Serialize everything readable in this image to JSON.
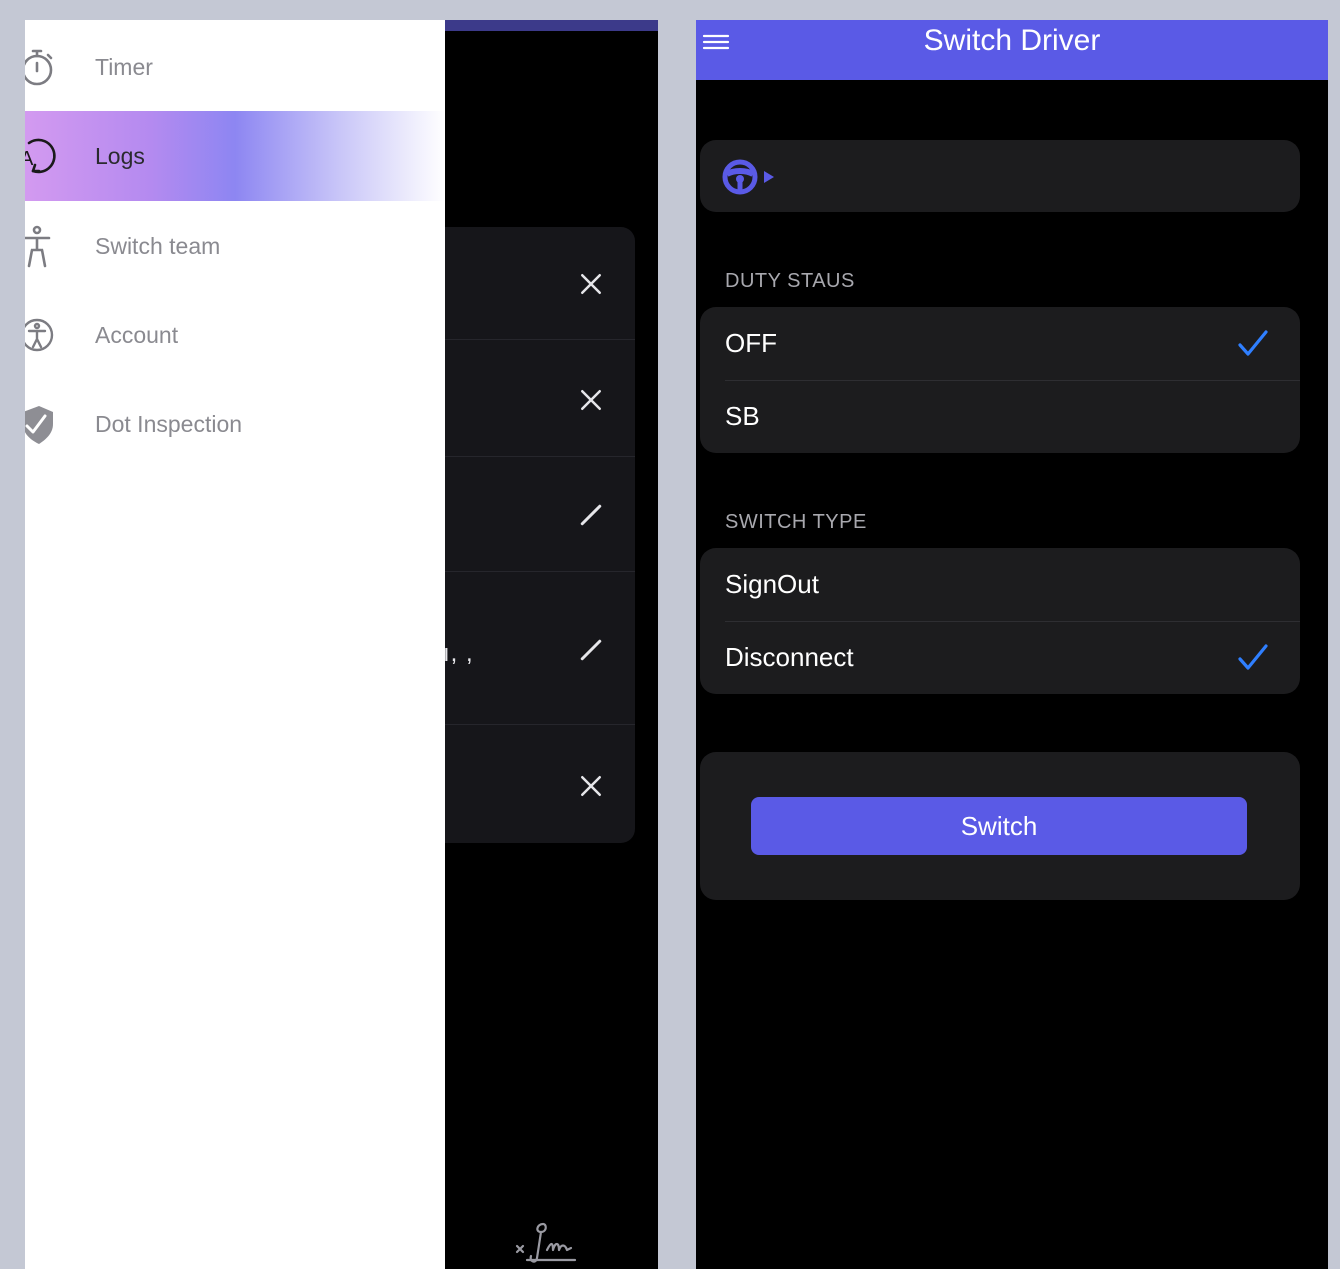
{
  "drawer": {
    "items": [
      {
        "label": "Timer",
        "icon": "timer-icon",
        "active": false
      },
      {
        "label": "Logs",
        "icon": "logs-icon",
        "active": true
      },
      {
        "label": "Switch team",
        "icon": "switch-team-icon",
        "active": false
      },
      {
        "label": "Account",
        "icon": "account-icon",
        "active": false
      },
      {
        "label": "Dot Inspection",
        "icon": "shield-check-icon",
        "active": false
      }
    ]
  },
  "behind": {
    "partial_text": "ı, ,",
    "actions": [
      "close-icon",
      "close-icon",
      "edit-icon",
      "edit-icon",
      "close-icon"
    ]
  },
  "switch_driver": {
    "title": "Switch Driver",
    "driver_icon": "steering-wheel-icon",
    "duty_status": {
      "label": "DUTY STAUS",
      "options": [
        {
          "label": "OFF",
          "checked": true
        },
        {
          "label": "SB",
          "checked": false
        }
      ]
    },
    "switch_type": {
      "label": "SWITCH TYPE",
      "options": [
        {
          "label": "SignOut",
          "checked": false
        },
        {
          "label": "Disconnect",
          "checked": true
        }
      ]
    },
    "button_label": "Switch"
  },
  "colors": {
    "accent": "#5a5ae6",
    "check": "#2f7fff",
    "card": "#1c1c1e",
    "background": "#000000"
  }
}
